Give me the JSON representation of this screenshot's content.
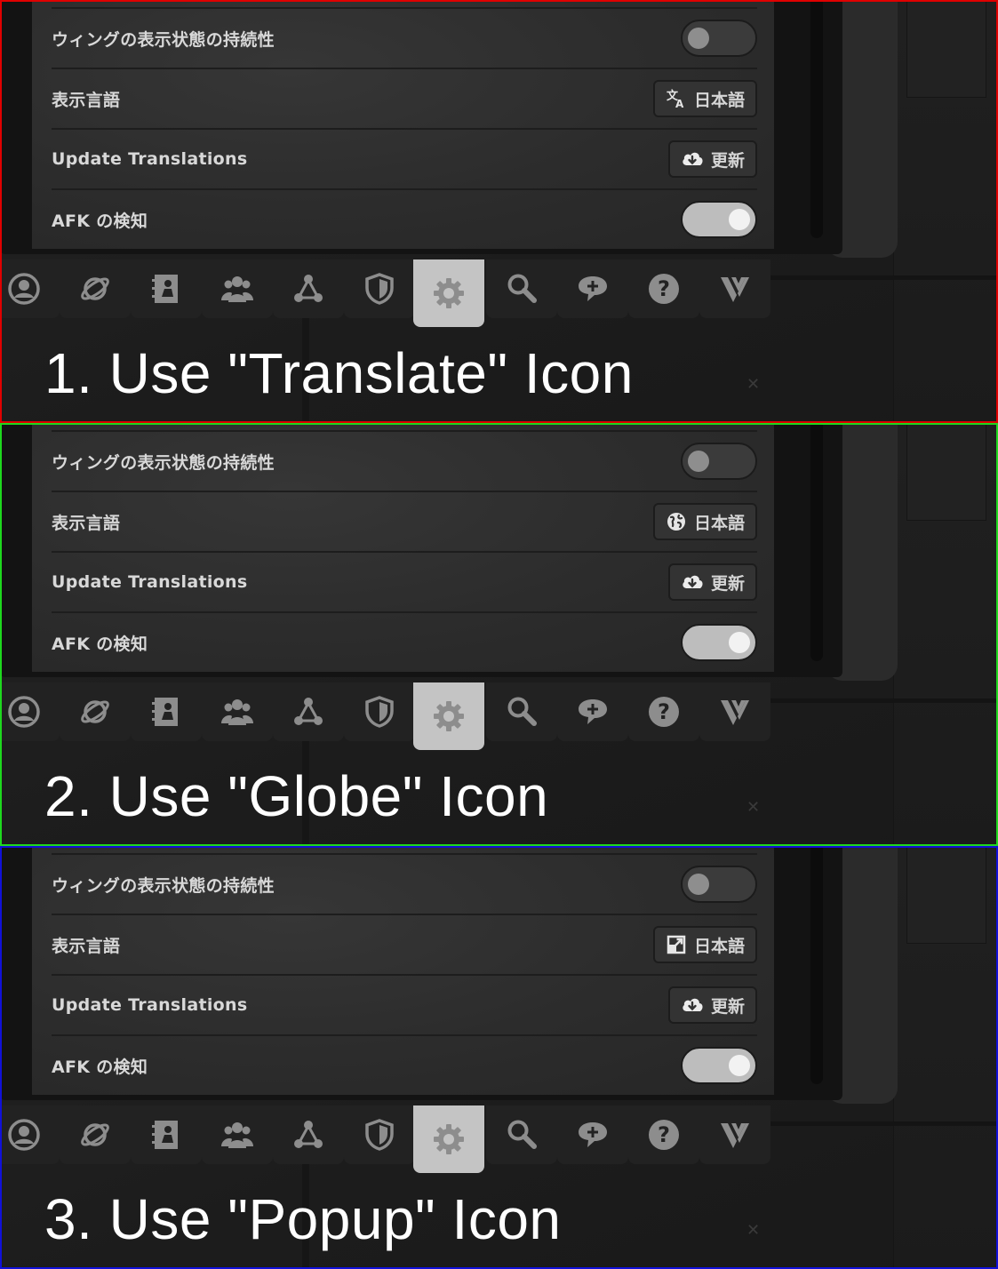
{
  "variants": [
    {
      "frame_color": "#e00000",
      "caption": "1. Use \"Translate\" Icon",
      "settings": {
        "wing_persistence_label": "ウィングの表示状態の持続性",
        "wing_persistence_on": false,
        "language_label": "表示言語",
        "language_value": "日本語",
        "language_icon": "translate-icon",
        "update_translations_label": "Update Translations",
        "update_button_label": "更新",
        "update_icon": "cloud-download-icon",
        "afk_label": "AFK の検知",
        "afk_on": true
      }
    },
    {
      "frame_color": "#1ed81e",
      "caption": "2. Use \"Globe\" Icon",
      "settings": {
        "wing_persistence_label": "ウィングの表示状態の持続性",
        "wing_persistence_on": false,
        "language_label": "表示言語",
        "language_value": "日本語",
        "language_icon": "globe-icon",
        "update_translations_label": "Update Translations",
        "update_button_label": "更新",
        "update_icon": "cloud-download-icon",
        "afk_label": "AFK の検知",
        "afk_on": true
      }
    },
    {
      "frame_color": "#1010d8",
      "caption": "3. Use \"Popup\" Icon",
      "settings": {
        "wing_persistence_label": "ウィングの表示状態の持続性",
        "wing_persistence_on": false,
        "language_label": "表示言語",
        "language_value": "日本語",
        "language_icon": "popup-icon",
        "update_translations_label": "Update Translations",
        "update_button_label": "更新",
        "update_icon": "cloud-download-icon",
        "afk_label": "AFK の検知",
        "afk_on": true
      }
    }
  ],
  "tabbar": {
    "tabs": [
      {
        "icon": "profile-icon",
        "active": false
      },
      {
        "icon": "worlds-planet-icon",
        "active": false
      },
      {
        "icon": "avatars-icon",
        "active": false
      },
      {
        "icon": "social-people-icon",
        "active": false
      },
      {
        "icon": "groups-network-icon",
        "active": false
      },
      {
        "icon": "safety-shield-icon",
        "active": false
      },
      {
        "icon": "settings-gear-icon",
        "active": true
      },
      {
        "icon": "search-icon",
        "active": false
      },
      {
        "icon": "chat-add-icon",
        "active": false
      },
      {
        "icon": "help-question-icon",
        "active": false
      },
      {
        "icon": "vrchat-logo-icon",
        "active": false
      }
    ]
  }
}
